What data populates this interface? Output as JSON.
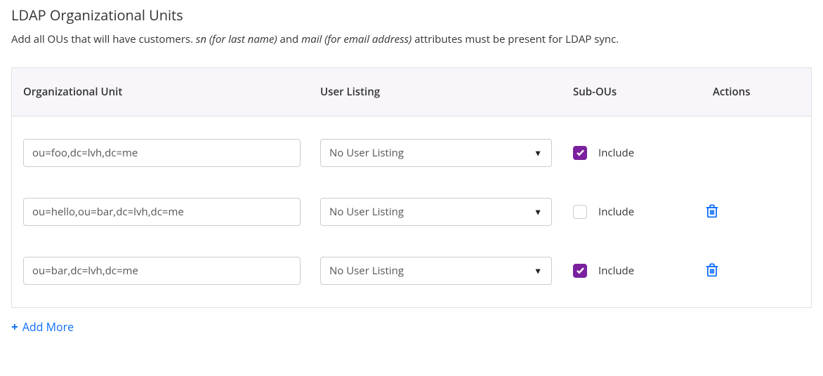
{
  "section": {
    "title": "LDAP Organizational Units",
    "desc_pre": "Add all OUs that will have customers. ",
    "desc_sn": "sn (for last name)",
    "desc_and": " and ",
    "desc_mail": "mail (for email address)",
    "desc_post": " attributes must be present for LDAP sync."
  },
  "table": {
    "headers": {
      "ou": "Organizational Unit",
      "listing": "User Listing",
      "sub": "Sub-OUs",
      "actions": "Actions"
    },
    "rows": [
      {
        "ou_value": "ou=foo,dc=lvh,dc=me",
        "listing_value": "No User Listing",
        "include_checked": true,
        "include_label": "Include",
        "show_delete": false
      },
      {
        "ou_value": "ou=hello,ou=bar,dc=lvh,dc=me",
        "listing_value": "No User Listing",
        "include_checked": false,
        "include_label": "Include",
        "show_delete": true
      },
      {
        "ou_value": "ou=bar,dc=lvh,dc=me",
        "listing_value": "No User Listing",
        "include_checked": true,
        "include_label": "Include",
        "show_delete": true
      }
    ]
  },
  "add_more_label": "Add More"
}
